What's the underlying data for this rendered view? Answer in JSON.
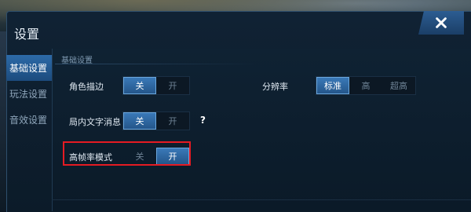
{
  "window": {
    "title": "设置",
    "close_icon": "close-icon"
  },
  "sidebar": {
    "items": [
      {
        "label": "基础设置",
        "active": true
      },
      {
        "label": "玩法设置",
        "active": false
      },
      {
        "label": "音效设置",
        "active": false
      }
    ]
  },
  "section": {
    "title": "基础设置"
  },
  "settings": {
    "outline": {
      "label": "角色描边",
      "options": [
        "关",
        "开"
      ],
      "selected": "关"
    },
    "in_game_text": {
      "label": "局内文字消息",
      "options": [
        "关",
        "开"
      ],
      "selected": "关",
      "help": "?"
    },
    "high_fps": {
      "label": "高帧率模式",
      "options": [
        "关",
        "开"
      ],
      "selected": "开"
    },
    "resolution": {
      "label": "分辨率",
      "options": [
        "标准",
        "高",
        "超高"
      ],
      "selected": "标准"
    }
  },
  "colors": {
    "accent": "#2d6aa8",
    "highlight_border": "#e51b23"
  }
}
